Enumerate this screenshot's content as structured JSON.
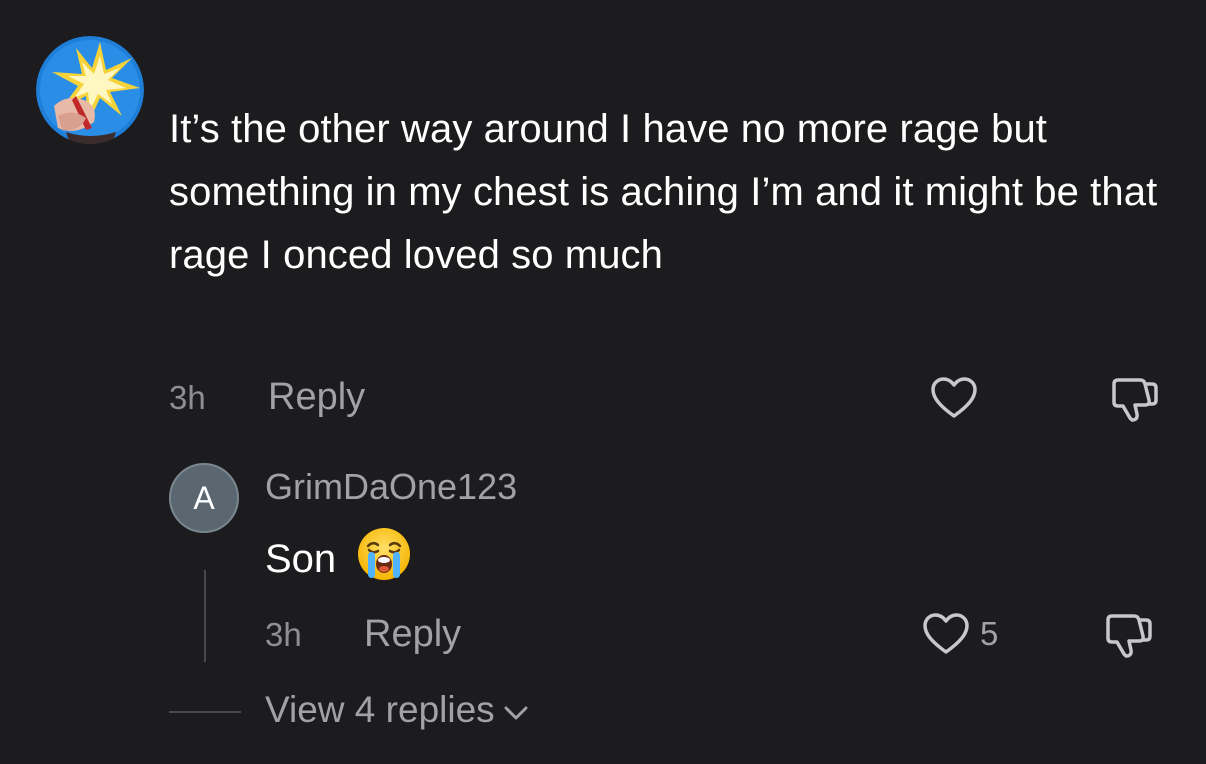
{
  "comment": {
    "text": "It’s the other way around I have no more rage but something in my chest is aching I’m and it might be that rage I onced loved so much",
    "time": "3h",
    "reply_label": "Reply",
    "like_icon": "heart-icon",
    "dislike_icon": "thumbs-down-icon"
  },
  "reply": {
    "avatar_initial": "A",
    "username": "GrimDaOne123",
    "text": "Son",
    "emoji": "loudly-crying-face",
    "time": "3h",
    "reply_label": "Reply",
    "like_count": "5",
    "like_icon": "heart-icon",
    "dislike_icon": "thumbs-down-icon"
  },
  "view_replies": {
    "label": "View 4 replies",
    "icon": "chevron-down-icon"
  },
  "colors": {
    "background": "#1c1c1e",
    "primary_text": "#ffffff",
    "secondary_text": "#a1a1a6",
    "reply_avatar": "#5a6771"
  }
}
